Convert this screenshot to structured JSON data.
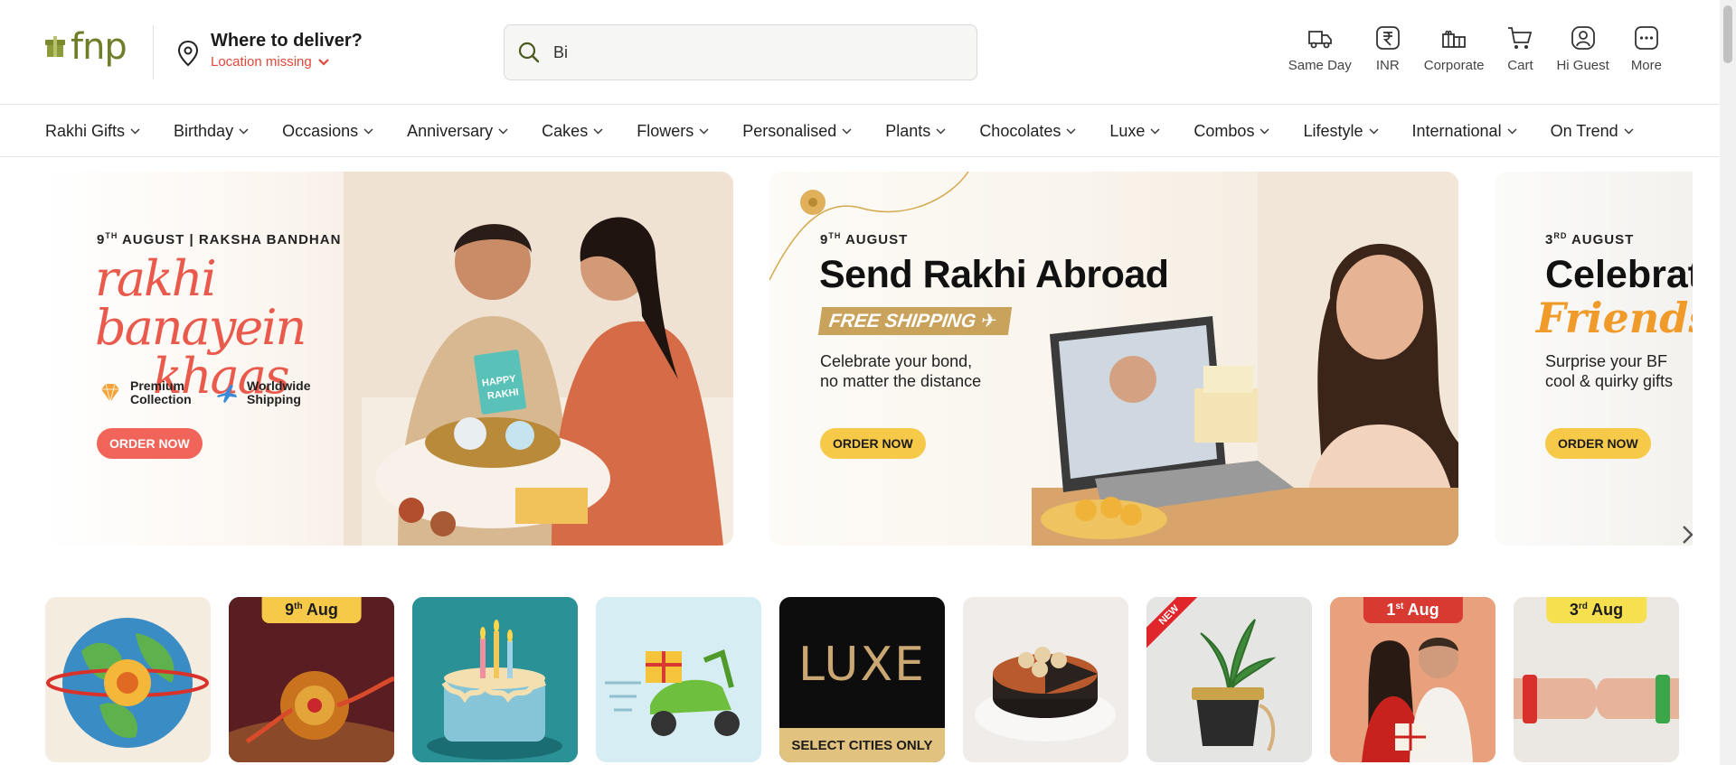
{
  "brand": {
    "logo_text": "fnp",
    "accent": "#6f7d28"
  },
  "deliver": {
    "title": "Where to deliver?",
    "location_status": "Location missing",
    "status_color": "#e0483a"
  },
  "search": {
    "value": "Bi",
    "placeholder": ""
  },
  "actions": [
    {
      "label": "Same Day",
      "icon": "truck-icon"
    },
    {
      "label": "INR",
      "icon": "rupee-icon"
    },
    {
      "label": "Corporate",
      "icon": "gift-boxes-icon"
    },
    {
      "label": "Cart",
      "icon": "cart-icon"
    },
    {
      "label": "Hi Guest",
      "icon": "user-icon"
    },
    {
      "label": "More",
      "icon": "more-icon"
    }
  ],
  "nav": [
    "Rakhi Gifts",
    "Birthday",
    "Occasions",
    "Anniversary",
    "Cakes",
    "Flowers",
    "Personalised",
    "Plants",
    "Chocolates",
    "Luxe",
    "Combos",
    "Lifestyle",
    "International",
    "On Trend"
  ],
  "banners": [
    {
      "eyebrow_day": "9",
      "eyebrow_suffix": "TH",
      "eyebrow_rest": " AUGUST | RAKSHA BANDHAN",
      "script_line1": "rakhi banayein",
      "script_line2": "khaas",
      "feature1_line1": "Premium",
      "feature1_line2": "Collection",
      "feature2_line1": "Worldwide",
      "feature2_line2": "Shipping",
      "card_text": "HAPPY RAKHI",
      "cta": "ORDER NOW"
    },
    {
      "eyebrow_day": "9",
      "eyebrow_suffix": "TH",
      "eyebrow_rest": " AUGUST",
      "headline": "Send Rakhi Abroad",
      "tag": "FREE SHIPPING ✈",
      "sub_line1": "Celebrate your bond,",
      "sub_line2": "no matter the distance",
      "cta": "ORDER NOW"
    },
    {
      "eyebrow_day": "3",
      "eyebrow_suffix": "RD",
      "eyebrow_rest": " AUGUST",
      "headline": "Celebrat",
      "script": "Friendsh",
      "sub_line1": "Surprise your BF",
      "sub_line2": "cool & quirky gifts",
      "cta": "ORDER NOW"
    }
  ],
  "tiles": [
    {
      "name": "international",
      "tag": ""
    },
    {
      "name": "rakhi",
      "tag_day": "9",
      "tag_suffix": "th",
      "tag_rest": " Aug"
    },
    {
      "name": "birthday-cake",
      "tag": ""
    },
    {
      "name": "same-day-delivery",
      "tag": ""
    },
    {
      "name": "luxe",
      "title": "LUXE",
      "footer": "SELECT CITIES ONLY"
    },
    {
      "name": "cakes",
      "tag": ""
    },
    {
      "name": "plants",
      "ribbon": "NEW"
    },
    {
      "name": "friendship-couple",
      "tag_day": "1",
      "tag_suffix": "st",
      "tag_rest": " Aug"
    },
    {
      "name": "friendship-bands",
      "tag_day": "3",
      "tag_suffix": "rd",
      "tag_rest": " Aug"
    }
  ]
}
